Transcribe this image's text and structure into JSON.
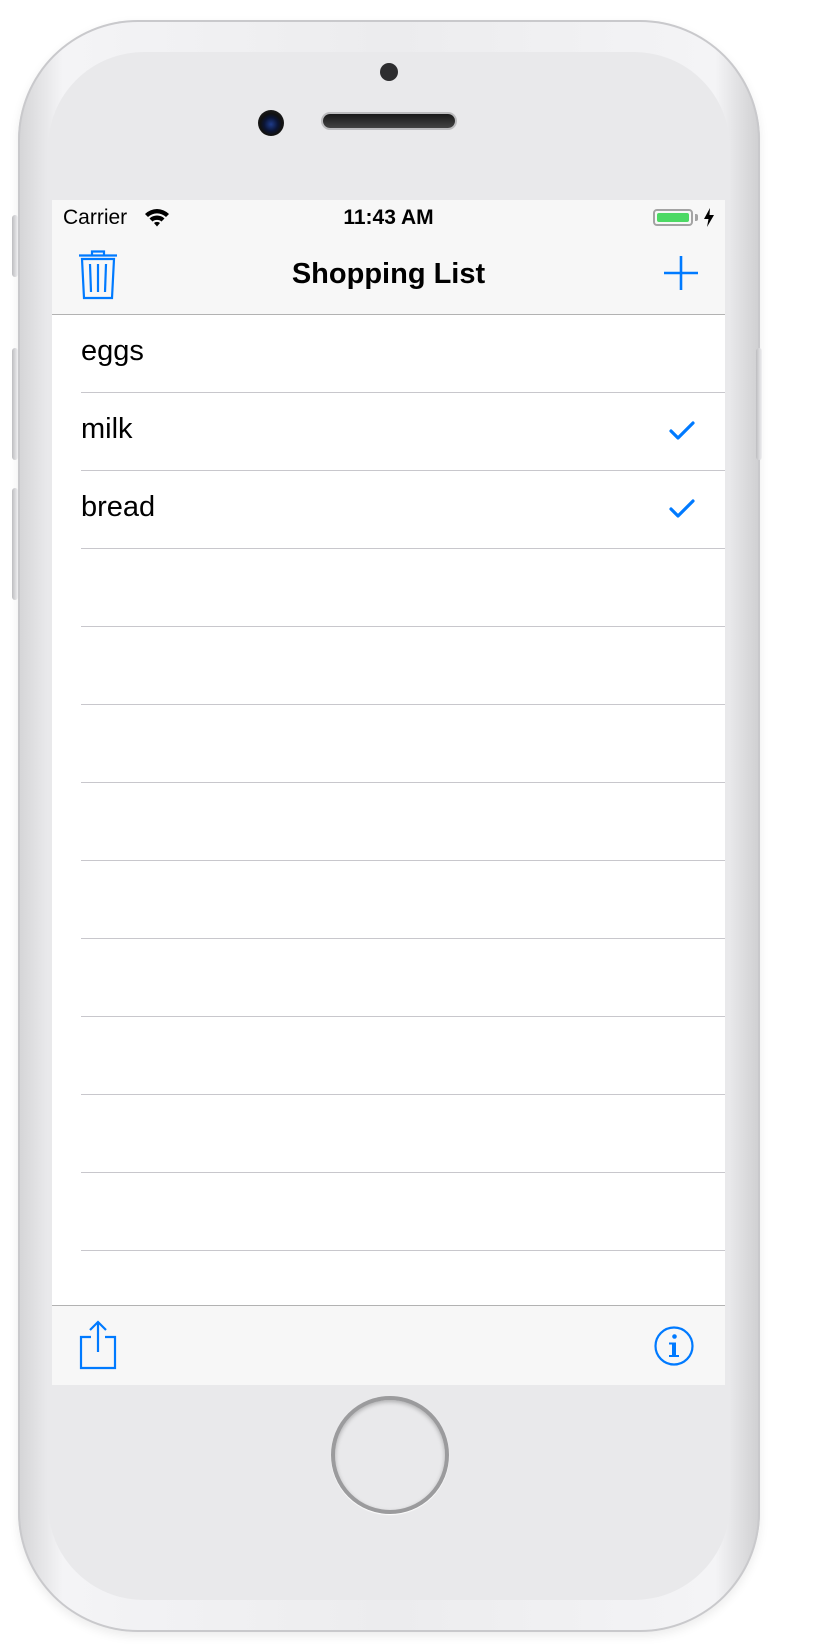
{
  "status_bar": {
    "carrier": "Carrier",
    "time": "11:43 AM",
    "battery_level": 1.0
  },
  "nav": {
    "title": "Shopping List"
  },
  "items": [
    {
      "label": "eggs",
      "checked": false
    },
    {
      "label": "milk",
      "checked": true
    },
    {
      "label": "bread",
      "checked": true
    }
  ],
  "empty_rows": 10,
  "toolbar": {
    "left_icon": "share-icon",
    "right_icon": "info-icon"
  },
  "colors": {
    "accent": "#007aff",
    "battery": "#4cd964",
    "bar_bg": "#f7f7f7",
    "separator": "#c8c7cc"
  }
}
